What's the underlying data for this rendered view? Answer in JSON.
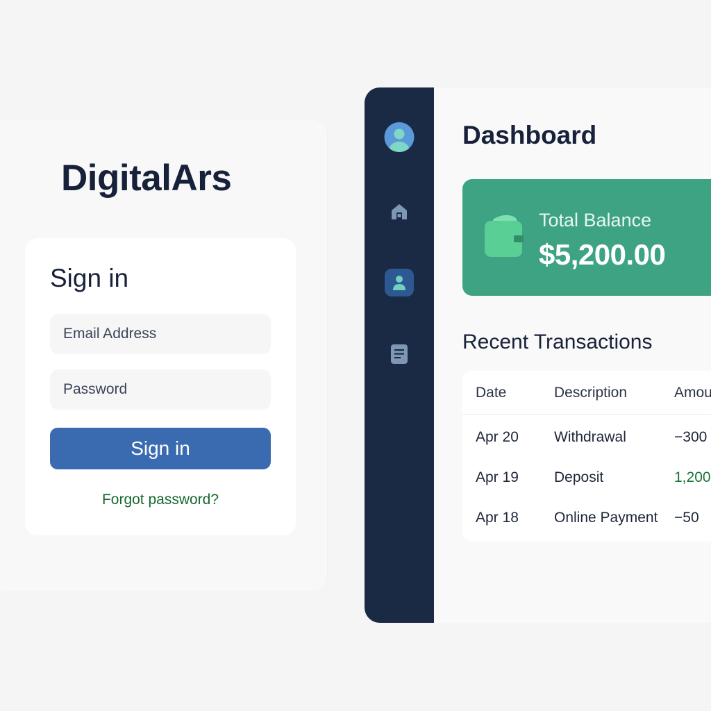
{
  "login": {
    "brand": "DigitalArs",
    "heading": "Sign in",
    "email_placeholder": "Email Address",
    "password_placeholder": "Password",
    "submit_label": "Sign in",
    "forgot_label": "Forgot password?"
  },
  "sidebar": {
    "icons": [
      "avatar-icon",
      "home-icon",
      "profile-icon",
      "document-icon"
    ],
    "active": "profile-icon"
  },
  "dashboard": {
    "title": "Dashboard",
    "balance": {
      "label": "Total Balance",
      "value": "$5,200.00"
    },
    "transactions": {
      "title": "Recent Transactions",
      "headers": [
        "Date",
        "Description",
        "Amou"
      ],
      "rows": [
        {
          "date": "Apr 20",
          "description": "Withdrawal",
          "amount": "−300",
          "type": "negative"
        },
        {
          "date": "Apr 19",
          "description": "Deposit",
          "amount": "1,200",
          "type": "positive"
        },
        {
          "date": "Apr 18",
          "description": "Online Payment",
          "amount": "−50",
          "type": "negative"
        }
      ]
    }
  },
  "colors": {
    "sidebar": "#1b2a44",
    "primary_button": "#3a6bb1",
    "balance_card": "#3ea383",
    "link": "#15682f",
    "positive_amount": "#1d7338"
  }
}
